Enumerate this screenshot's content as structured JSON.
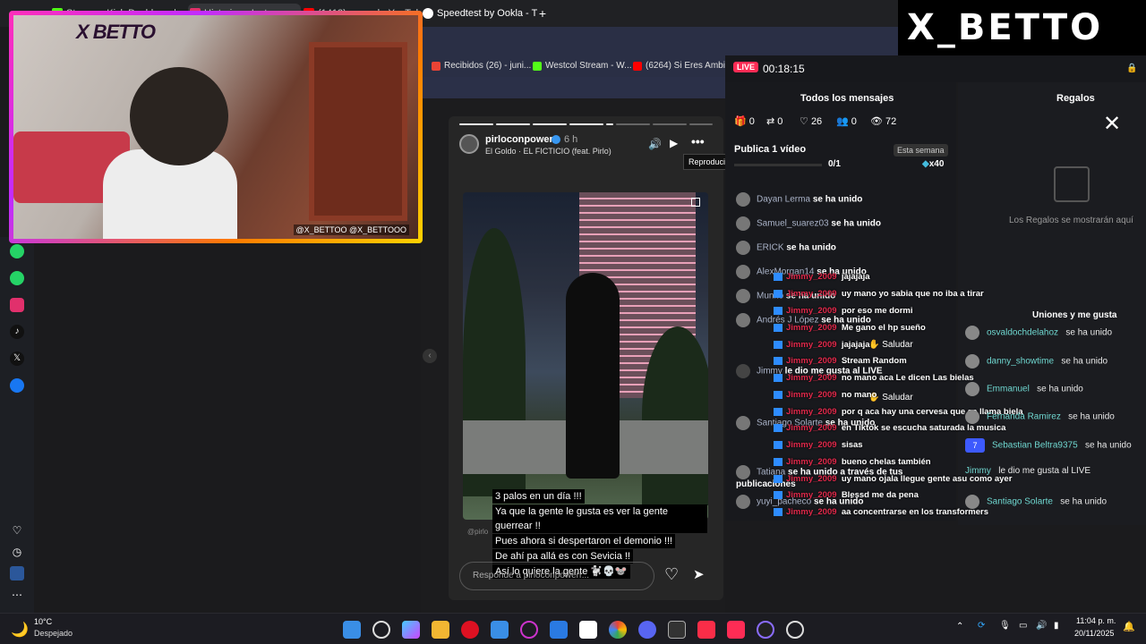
{
  "browser": {
    "tabs": [
      {
        "label": "Stream - Kick Dashboard",
        "color": "#53fc18"
      },
      {
        "label": "Historias • Instagram",
        "color": "#e1306c"
      },
      {
        "label": "(1413) arnaud - YouTube",
        "color": "#ff0000"
      },
      {
        "label": "Speedtest by Ookla - The",
        "color": "#ffffff"
      }
    ],
    "new_tab": "+",
    "bookmarks": [
      {
        "label": "Recibidos (26) - juni...",
        "color": "#ea4335"
      },
      {
        "label": "Westcol Stream - W...",
        "color": "#53fc18"
      },
      {
        "label": "(6264) Si Eres Ambi...",
        "color": "#ff0000"
      }
    ]
  },
  "webcam": {
    "title": "X BETTO",
    "social": "@X_BETTOO  @X_BETTOOO"
  },
  "story": {
    "username": "pirloconpowerr",
    "time": "6 h",
    "song": "El Goldo · EL FICTICIO (feat. Pirlo)",
    "tooltip": "Reproducir",
    "caption_lines": [
      "3 palos en un día !!!",
      "Ya que la gente le gusta es ver la gente guerrear !!",
      "Pues ahora si despertaron el demonio !!!",
      "De ahí pa allá es con Sevicia !!",
      "Así lo quiere la gente 🐩💀🐭"
    ],
    "reply_placeholder": "Responde a pirloconpowerr...",
    "watermark": "@pirlo"
  },
  "live_panel": {
    "badge": "LIVE",
    "timer": "00:18:15",
    "all_messages_tab": "Todos los mensajes",
    "gifts_tab": "Regalos",
    "stats": [
      "0",
      "0",
      "26",
      "0",
      "72"
    ],
    "goal_title": "Publica 1 vídeo",
    "goal_period": "Esta semana",
    "goal_progress": "0/1",
    "goal_reward": "x40",
    "gifts_empty": "Los Regalos se mostrarán aquí",
    "joins_title": "Uniones y me gusta",
    "chat_rows": [
      {
        "name": "Dayan Lerma",
        "text": "se ha unido"
      },
      {
        "name": "Samuel_suarez03",
        "text": "se ha unido"
      },
      {
        "name": "ERICK",
        "text": "se ha unido"
      },
      {
        "name": "AlexMorgan14",
        "text": "se ha unido"
      },
      {
        "name": "Munito",
        "text": "se ha unido"
      },
      {
        "name": "Andrés J López",
        "text": "se ha unido"
      },
      {
        "name": "Jimmy",
        "text": "le dio me gusta al LIVE"
      },
      {
        "name": "Santiago Solarte",
        "text": "se ha unido"
      },
      {
        "name": "Tatiana",
        "text": "se ha unido a través de tus publicaciones"
      },
      {
        "name": "yuyi_pacheco",
        "text": "se ha unido"
      }
    ],
    "greet_label": "Saludar",
    "overlay_user": "Jimmy_2009",
    "overlay_msgs": [
      "jajajaja",
      "uy mano yo sabia que no iba a tirar",
      "por eso me dormi",
      "Me gano el hp sueño",
      "jajajaja",
      "Stream Random",
      "no mano aca Le dicen Las bielas",
      "no mano",
      "por q aca hay una cervesa que se llama biela",
      "en Tiktok se escucha saturada la musica",
      "sisas",
      "bueno chelas también",
      "uy mano ojala llegue gente asu como ayer",
      "Blessd me da pena",
      "aa concentrarse en los transformers"
    ],
    "joins": [
      {
        "name": "osvaldochdelahoz",
        "text": "se ha unido"
      },
      {
        "name": "danny_showtime",
        "text": "se ha unido"
      },
      {
        "name": "Emmanuel",
        "text": "se ha unido"
      },
      {
        "name": "Fernanda Ramirez",
        "text": "se ha unido"
      },
      {
        "name": "Sebastian Beltra9375",
        "text": "se ha unido"
      },
      {
        "name": "Jimmy",
        "text": "le dio me gusta al LIVE"
      },
      {
        "name": "Santiago Solarte",
        "text": "se ha unido"
      }
    ],
    "join_badge": "7"
  },
  "brand": {
    "text": "X_BETTO"
  },
  "taskbar": {
    "temp": "10°C",
    "weather": "Despejado",
    "time": "11:04 p. m.",
    "date": "20/11/2025"
  }
}
